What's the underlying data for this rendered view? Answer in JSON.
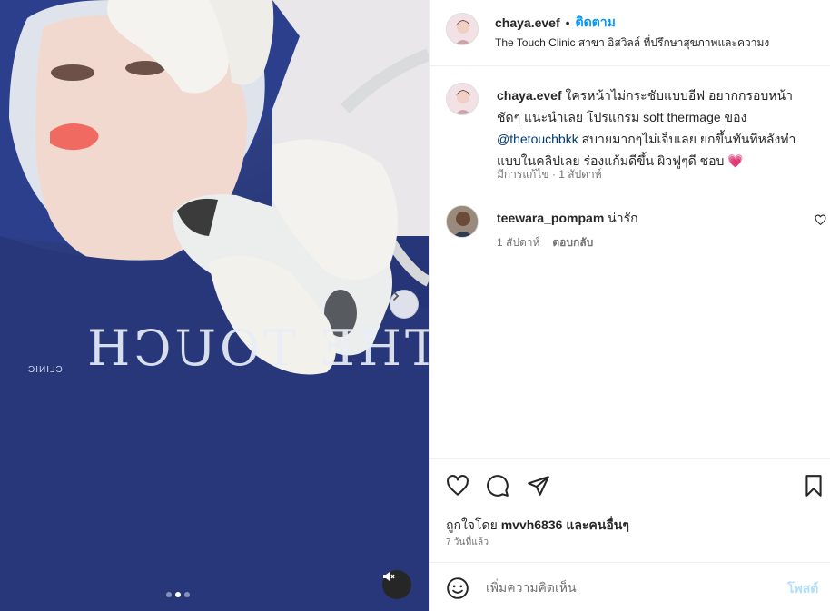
{
  "post": {
    "username": "chaya.evef",
    "separator": "•",
    "follow_label": "ติดตาม",
    "location": "The Touch Clinic สาขา อิสวิลล์ ที่ปรึกษาสุขภาพและความง"
  },
  "media": {
    "shirt_text": "THE TOUCH",
    "shirt_subtext": "CLINIC",
    "carousel_total": 3,
    "carousel_active": 2
  },
  "caption": {
    "username": "chaya.evef",
    "text_before_mention": "ใครหน้าไม่กระชับแบบอีฟ อยากกรอบหน้าชัดๆ แนะนำเลย โปรแกรม soft thermage ของ",
    "mention": "@thetouchbkk",
    "text_after_mention": "สบายมากๆไม่เจ็บเลย ยกขึ้นทันทีหลังทำแบบในคลิปเลย ร่องแก้มดีขึ้น ผิวฟูๆดี ชอบ",
    "emoji": "💗",
    "edited_label": "มีการแก้ไข",
    "meta_separator": "·",
    "time": "1 สัปดาห์"
  },
  "comment": {
    "username": "teewara_pompam",
    "text": "น่ารัก",
    "time": "1 สัปดาห์",
    "reply_label": "ตอบกลับ"
  },
  "likes": {
    "prefix": "ถูกใจโดย",
    "user": "mvvh6836",
    "suffix": "และคนอื่นๆ"
  },
  "post_time": "7 วันที่แล้ว",
  "add_comment": {
    "placeholder": "เพิ่มความคิดเห็น",
    "post_label": "โพสต์"
  },
  "icons": {
    "like": "heart-icon",
    "comment": "comment-icon",
    "share": "paper-plane-icon",
    "save": "bookmark-icon",
    "emoji": "smiley-icon",
    "mute": "speaker-muted-icon",
    "next": "chevron-right-icon"
  },
  "colors": {
    "accent": "#0095f6",
    "mention": "#00376b",
    "muted_text": "#737373",
    "post_disabled": "#b2dffc",
    "shirt_blue": "#27377a"
  }
}
